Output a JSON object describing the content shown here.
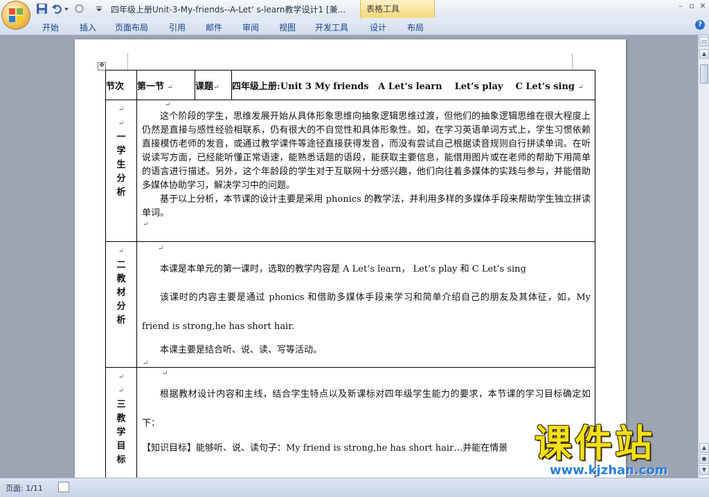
{
  "window": {
    "title": "四年级上册Unit-3-My-friends--A-Let’ s-learn教学设计1 [兼...",
    "context_tab": "表格工具",
    "controls": [
      "–",
      "▫",
      "✕"
    ]
  },
  "ribbon": {
    "tabs": [
      "开始",
      "插入",
      "页面布局",
      "引用",
      "邮件",
      "审阅",
      "视图",
      "开发工具",
      "设计",
      "布局"
    ]
  },
  "table": {
    "header": {
      "section_label": "节次",
      "section_value": "第一节",
      "topic_label": "课题",
      "topic_value": "四年级上册:Unit 3 My friends   A Let’s learn    Let’s play    C Let’s sing"
    },
    "sections": [
      {
        "label_lines": [
          "一",
          "学",
          "生",
          "分",
          "析"
        ],
        "paragraphs": [
          "这个阶段的学生，思维发展开始从具体形象思维向抽象逻辑思维过渡，但他们的抽象逻辑思维在很大程度上仍然是直接与感性经验相联系，仍有很大的不自觉性和具体形象性。如，在学习英语单词方式上，学生习惯依赖直接模仿老师的发音，或通过教学课件等途径直接获得发音，而没有尝试自己根据读音规则自行拼读单词。在听说读写方面，已经能听懂正常语速，能熟悉话题的语段，能获取主要信息，能借用图片或在老师的帮助下用简单的语言进行描述。另外，这个年龄段的学生对于互联网十分感兴趣，他们向往着多媒体的实践与参与，并能借助多媒体协助学习，解决学习中的问题。",
          "基于以上分析，本节课的设计主要是采用 phonics 的教学法，并利用多样的多媒体手段来帮助学生独立拼读单词。"
        ]
      },
      {
        "label_lines": [
          "二",
          "教",
          "材",
          "分",
          "析"
        ],
        "paragraphs": [
          "本课是本单元的第一课时，选取的教学内容是 A Let’s learn，  Let’s play 和 C Let’s sing",
          "该课时的内容主要是通过  phonics  和借助多媒体手段来学习和简单介绍自己的朋友及其体征，如，My friend is strong,he has short hair.",
          "本课主要是结合听、说、读、写等活动。"
        ]
      },
      {
        "label_lines": [
          "三",
          "教",
          "学",
          "目",
          "标"
        ],
        "paragraphs": [
          "根据教材设计内容和主线，结合学生特点以及新课标对四年级学生能力的要求，本节课的学习目标确定如下：",
          "【知识目标】能够听、说、读句子：My friend is strong,he has short hair…并能在情景"
        ]
      }
    ]
  },
  "status": {
    "page": "页面: 1/11"
  },
  "watermark": {
    "title": "课件站",
    "url": "www.kjzhan.com"
  },
  "colors": {
    "accent": "#15428b",
    "context_tab": "#f5d97a",
    "watermark_yellow": "#f5df17",
    "watermark_blue": "#2a7fdb"
  }
}
